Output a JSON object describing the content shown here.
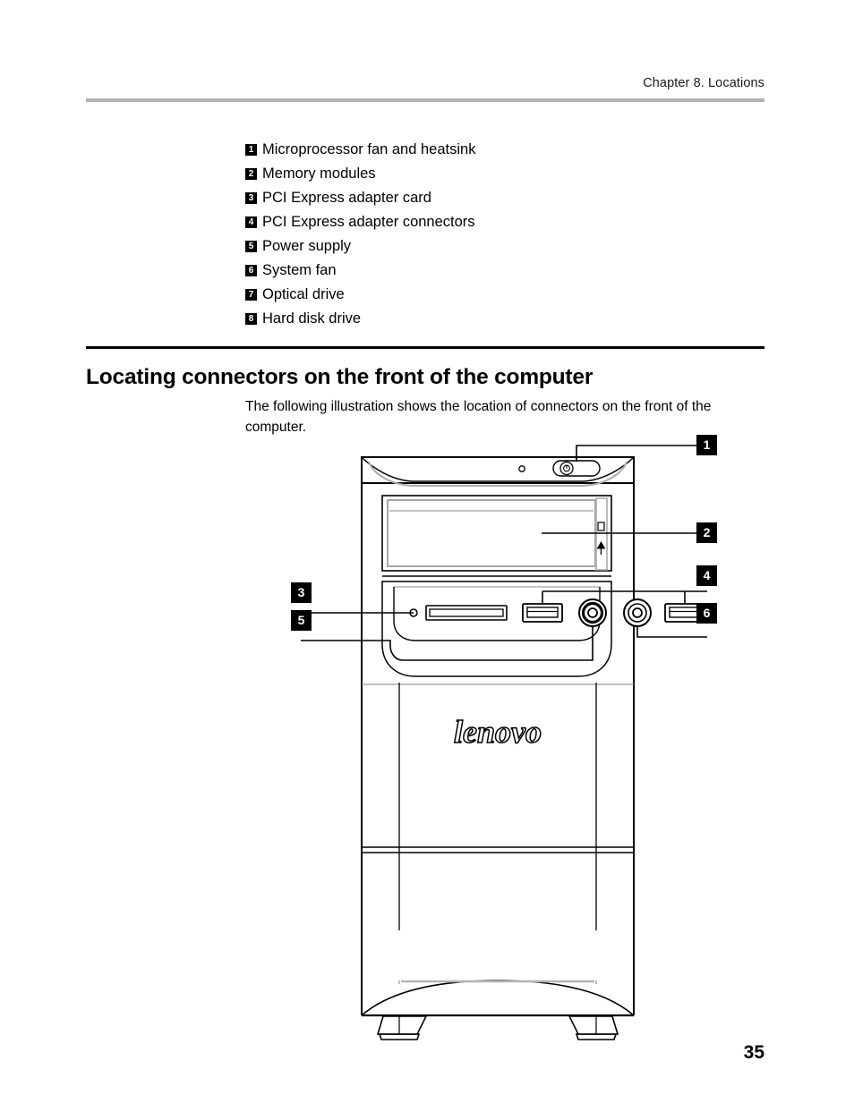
{
  "header": {
    "chapter": "Chapter 8. Locations"
  },
  "legend": {
    "items": [
      {
        "num": "1",
        "label": "Microprocessor fan and heatsink"
      },
      {
        "num": "2",
        "label": "Memory modules"
      },
      {
        "num": "3",
        "label": "PCI Express adapter card"
      },
      {
        "num": "4",
        "label": "PCI Express adapter connectors"
      },
      {
        "num": "5",
        "label": "Power supply"
      },
      {
        "num": "6",
        "label": "System fan"
      },
      {
        "num": "7",
        "label": "Optical drive"
      },
      {
        "num": "8",
        "label": "Hard disk drive"
      }
    ]
  },
  "section": {
    "heading": "Locating connectors on the front of the computer",
    "body": "The following illustration shows the location of connectors on the front of the computer."
  },
  "illustration": {
    "brand_logo": "lenovo",
    "callouts": [
      {
        "num": "1",
        "target": "power-button"
      },
      {
        "num": "2",
        "target": "optical-drive-bay"
      },
      {
        "num": "3",
        "target": "card-reader-slot"
      },
      {
        "num": "4",
        "target": "usb-connectors"
      },
      {
        "num": "5",
        "target": "microphone-connector"
      },
      {
        "num": "6",
        "target": "headphone-connector"
      }
    ]
  },
  "footer": {
    "page_number": "35"
  },
  "colors": {
    "header_rule": "#b2b2b2",
    "heading_rule": "#000000",
    "badge_bg": "#000000",
    "badge_text": "#ffffff",
    "line_art": "#000000",
    "line_art_light": "#9a9a9a",
    "page_bg": "#ffffff"
  }
}
